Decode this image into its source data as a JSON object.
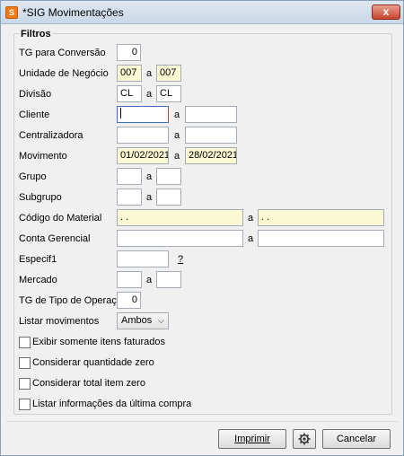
{
  "window": {
    "title": "*SIG Movimentações",
    "icon": "app-logo-icon",
    "close_label": "x"
  },
  "filters": {
    "title": "Filtros",
    "tg_conversao": {
      "label": "TG para Conversão",
      "value": "0"
    },
    "unidade": {
      "label": "Unidade de Negócio",
      "from": "007",
      "sep": "a",
      "to": "007"
    },
    "divisao": {
      "label": "Divisão",
      "from": "CL",
      "sep": "a",
      "to": "CL"
    },
    "cliente": {
      "label": "Cliente",
      "from": "",
      "sep": "a",
      "to": ""
    },
    "centralizadora": {
      "label": "Centralizadora",
      "from": "",
      "sep": "a",
      "to": ""
    },
    "movimento": {
      "label": "Movimento",
      "from": "01/02/2021",
      "sep": "a",
      "to": "28/02/2021"
    },
    "grupo": {
      "label": "Grupo",
      "from": "",
      "sep": "a",
      "to": ""
    },
    "subgrupo": {
      "label": "Subgrupo",
      "from": "",
      "sep": "a",
      "to": ""
    },
    "codigo_material": {
      "label": "Código do Material",
      "from": " .  .",
      "sep": "a",
      "to": " .  ."
    },
    "conta_gerencial": {
      "label": "Conta Gerencial",
      "from": "",
      "sep": "a",
      "to": ""
    },
    "especif1": {
      "label": "Especif1",
      "value": "",
      "help": "?"
    },
    "mercado": {
      "label": "Mercado",
      "from": "",
      "sep": "a",
      "to": ""
    },
    "tg_tipo_operacao": {
      "label": "TG de Tipo de Operação",
      "value": "0"
    },
    "listar_movimentos": {
      "label": "Listar movimentos",
      "selected": "Ambos"
    }
  },
  "checkboxes": [
    {
      "label": "Exibir somente itens faturados",
      "checked": false
    },
    {
      "label": "Considerar quantidade zero",
      "checked": false
    },
    {
      "label": "Considerar total item zero",
      "checked": false
    },
    {
      "label": "Listar informações da última compra",
      "checked": false
    }
  ],
  "buttons": {
    "print": "Imprimir",
    "settings_icon": "gear-icon",
    "cancel": "Cancelar"
  }
}
